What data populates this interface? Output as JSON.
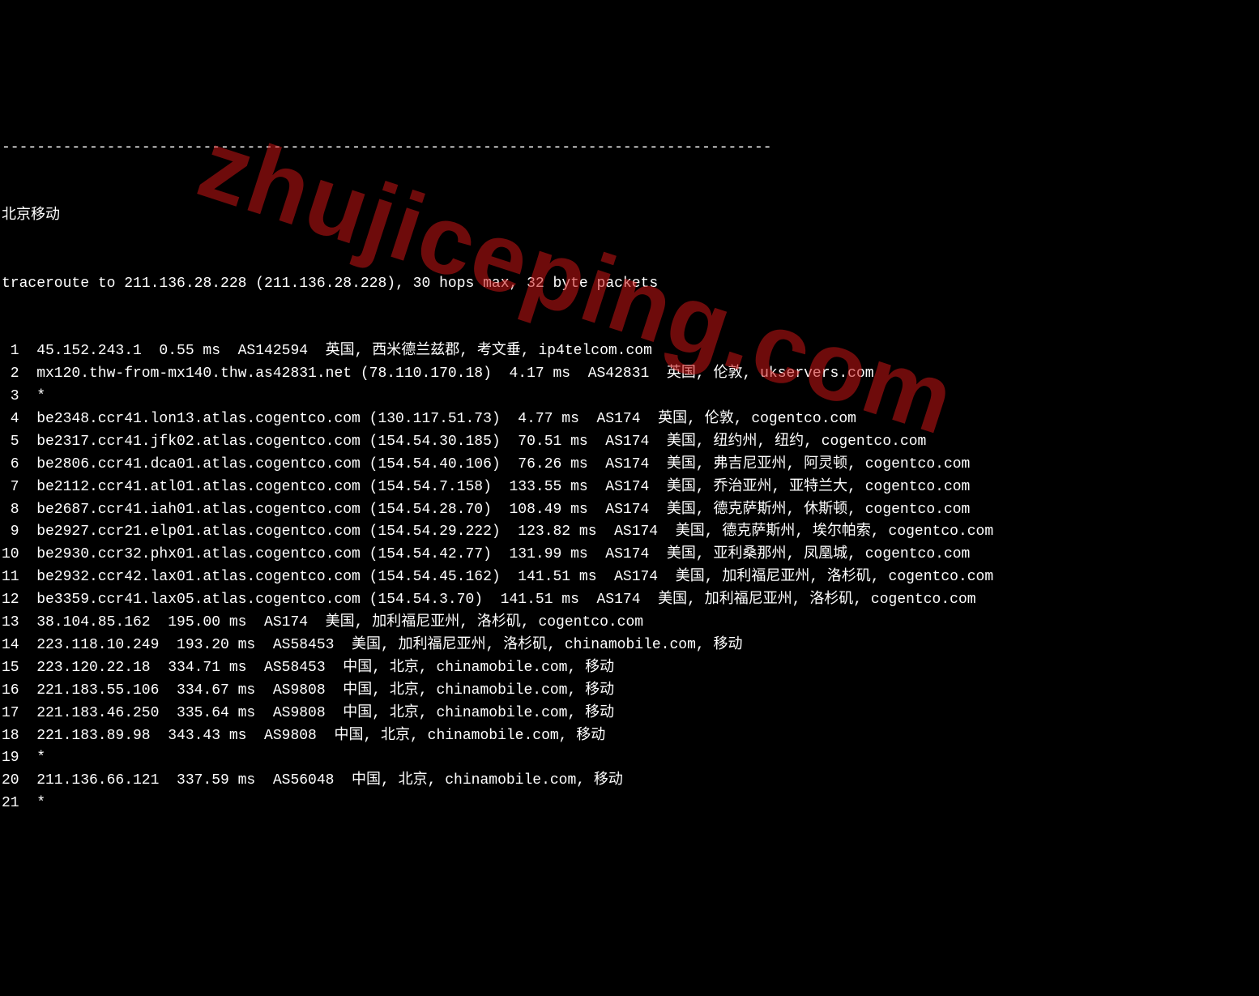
{
  "divider": "----------------------------------------------------------------------------------------",
  "title": "北京移动",
  "header": "traceroute to 211.136.28.228 (211.136.28.228), 30 hops max, 32 byte packets",
  "watermark": "zhujiceping.com",
  "hops": [
    {
      "num": "1",
      "rest": "45.152.243.1  0.55 ms  AS142594  英国, 西米德兰兹郡, 考文垂, ip4telcom.com"
    },
    {
      "num": "2",
      "rest": "mx120.thw-from-mx140.thw.as42831.net (78.110.170.18)  4.17 ms  AS42831  英国, 伦敦, ukservers.com"
    },
    {
      "num": "3",
      "rest": "*"
    },
    {
      "num": "4",
      "rest": "be2348.ccr41.lon13.atlas.cogentco.com (130.117.51.73)  4.77 ms  AS174  英国, 伦敦, cogentco.com"
    },
    {
      "num": "5",
      "rest": "be2317.ccr41.jfk02.atlas.cogentco.com (154.54.30.185)  70.51 ms  AS174  美国, 纽约州, 纽约, cogentco.com"
    },
    {
      "num": "6",
      "rest": "be2806.ccr41.dca01.atlas.cogentco.com (154.54.40.106)  76.26 ms  AS174  美国, 弗吉尼亚州, 阿灵顿, cogentco.com"
    },
    {
      "num": "7",
      "rest": "be2112.ccr41.atl01.atlas.cogentco.com (154.54.7.158)  133.55 ms  AS174  美国, 乔治亚州, 亚特兰大, cogentco.com"
    },
    {
      "num": "8",
      "rest": "be2687.ccr41.iah01.atlas.cogentco.com (154.54.28.70)  108.49 ms  AS174  美国, 德克萨斯州, 休斯顿, cogentco.com"
    },
    {
      "num": "9",
      "rest": "be2927.ccr21.elp01.atlas.cogentco.com (154.54.29.222)  123.82 ms  AS174  美国, 德克萨斯州, 埃尔帕索, cogentco.com"
    },
    {
      "num": "10",
      "rest": "be2930.ccr32.phx01.atlas.cogentco.com (154.54.42.77)  131.99 ms  AS174  美国, 亚利桑那州, 凤凰城, cogentco.com"
    },
    {
      "num": "11",
      "rest": "be2932.ccr42.lax01.atlas.cogentco.com (154.54.45.162)  141.51 ms  AS174  美国, 加利福尼亚州, 洛杉矶, cogentco.com"
    },
    {
      "num": "12",
      "rest": "be3359.ccr41.lax05.atlas.cogentco.com (154.54.3.70)  141.51 ms  AS174  美国, 加利福尼亚州, 洛杉矶, cogentco.com"
    },
    {
      "num": "13",
      "rest": "38.104.85.162  195.00 ms  AS174  美国, 加利福尼亚州, 洛杉矶, cogentco.com"
    },
    {
      "num": "14",
      "rest": "223.118.10.249  193.20 ms  AS58453  美国, 加利福尼亚州, 洛杉矶, chinamobile.com, 移动"
    },
    {
      "num": "15",
      "rest": "223.120.22.18  334.71 ms  AS58453  中国, 北京, chinamobile.com, 移动"
    },
    {
      "num": "16",
      "rest": "221.183.55.106  334.67 ms  AS9808  中国, 北京, chinamobile.com, 移动"
    },
    {
      "num": "17",
      "rest": "221.183.46.250  335.64 ms  AS9808  中国, 北京, chinamobile.com, 移动"
    },
    {
      "num": "18",
      "rest": "221.183.89.98  343.43 ms  AS9808  中国, 北京, chinamobile.com, 移动"
    },
    {
      "num": "19",
      "rest": "*"
    },
    {
      "num": "20",
      "rest": "211.136.66.121  337.59 ms  AS56048  中国, 北京, chinamobile.com, 移动"
    },
    {
      "num": "21",
      "rest": "*"
    }
  ]
}
